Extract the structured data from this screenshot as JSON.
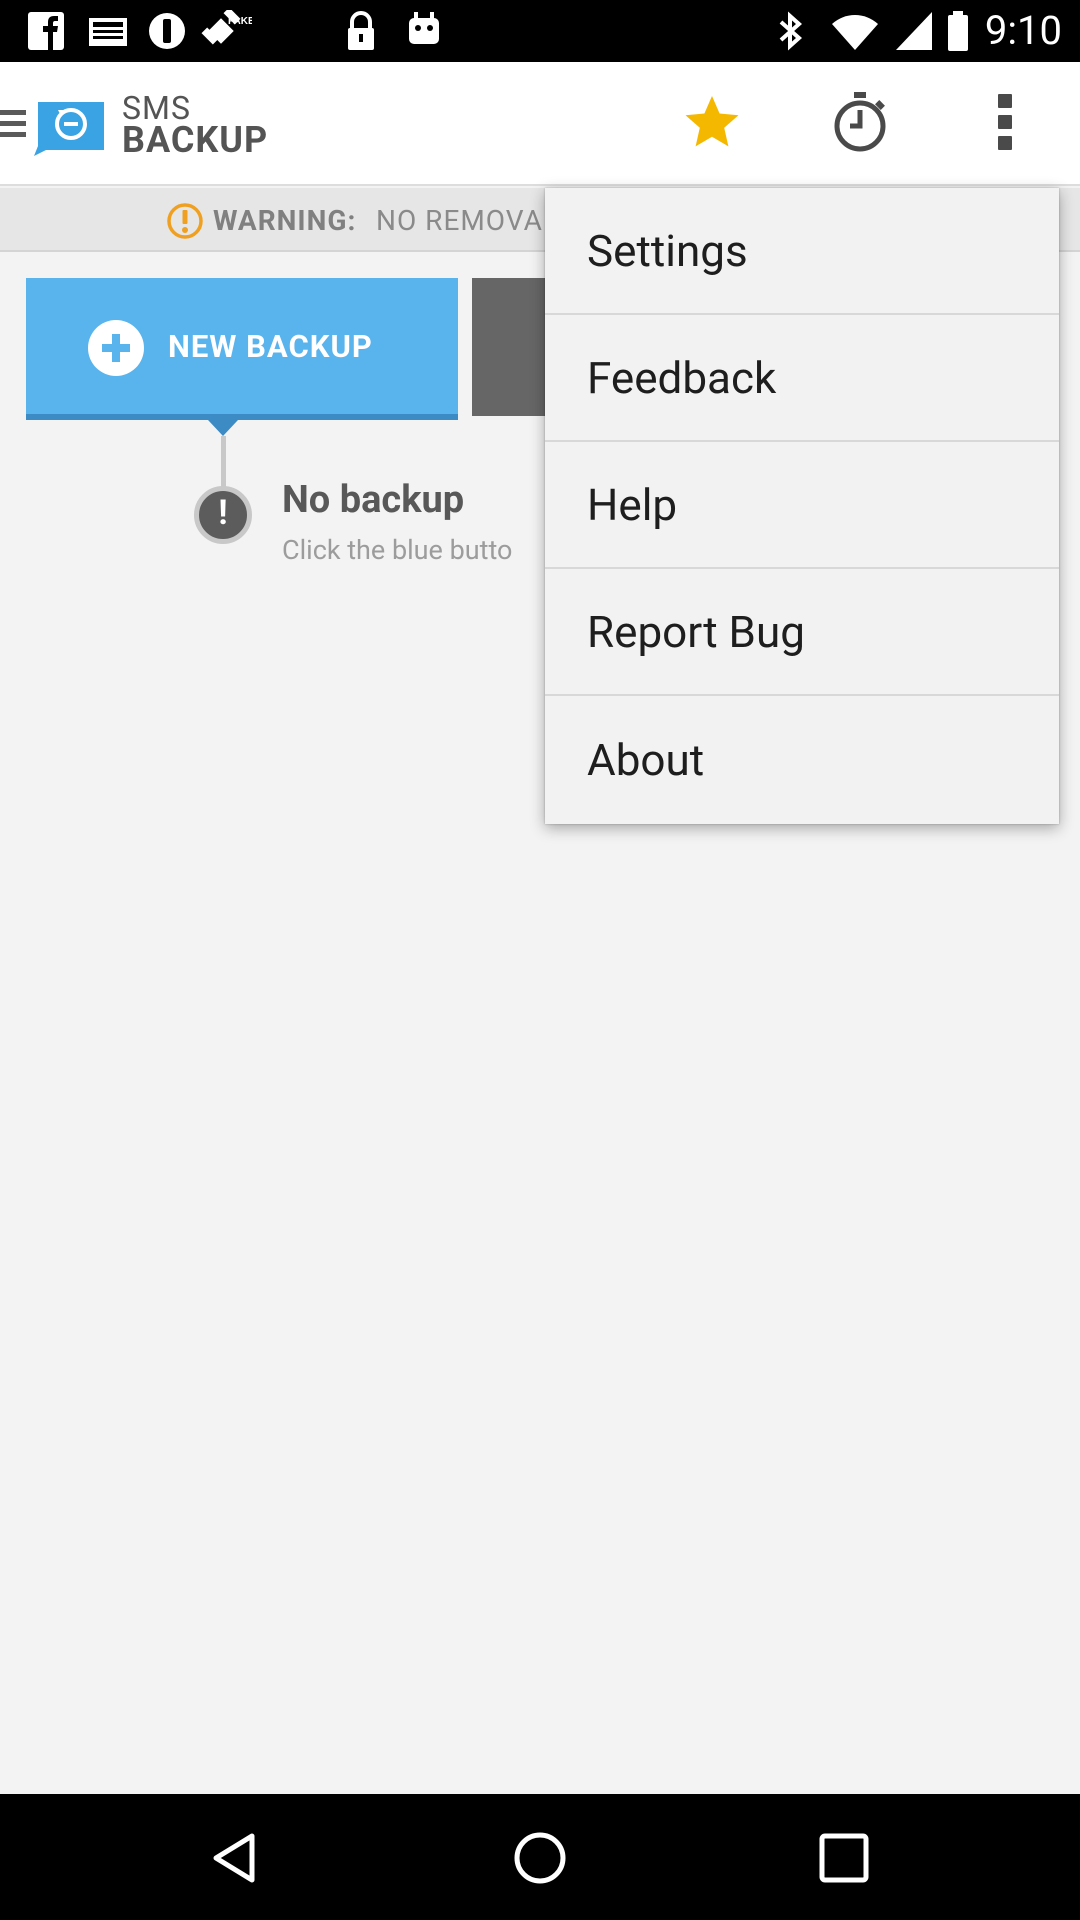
{
  "status_bar": {
    "time": "9:10",
    "left_icons": [
      "facebook-icon",
      "mail-icon",
      "no-disturb-icon",
      "fake-gps-icon",
      "lock-icon",
      "android-icon"
    ],
    "right_icons": [
      "bluetooth-icon",
      "wifi-icon",
      "signal-icon",
      "battery-icon"
    ]
  },
  "app_bar": {
    "logo_line1": "SMS",
    "logo_line2": "BACKUP",
    "actions": [
      "star-icon",
      "timer-icon",
      "overflow-menu-icon"
    ],
    "star_color": "#f5b800"
  },
  "warning": {
    "label": "WARNING:",
    "text": "NO REMOVA",
    "color": "#f0a020"
  },
  "main": {
    "new_backup_label": "NEW BACKUP",
    "new_backup_color": "#59b4ee",
    "no_backup_title": "No backup",
    "no_backup_subtitle": "Click the blue butto"
  },
  "overflow_menu": {
    "items": [
      {
        "label": "Settings"
      },
      {
        "label": "Feedback"
      },
      {
        "label": "Help"
      },
      {
        "label": "Report Bug"
      },
      {
        "label": "About"
      }
    ]
  },
  "nav_bar": {
    "buttons": [
      "back-icon",
      "home-icon",
      "recents-icon"
    ]
  }
}
